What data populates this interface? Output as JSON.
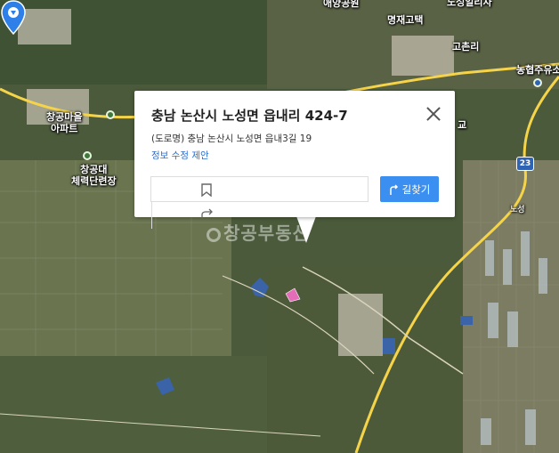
{
  "map": {
    "labels": [
      "애양공원",
      "명재고택",
      "노성일리사",
      "고촌리",
      "농협주유소",
      "창공마을\n아파트",
      "창공대\n체력단련장",
      "교",
      "노성"
    ],
    "route_badge": "23",
    "watermark": "창공부동산"
  },
  "popup": {
    "title": "충남 논산시 노성면 읍내리 424-7",
    "road_address": "(도로명) 충남 논산시 노성면 읍내3길 19",
    "edit_link": "정보 수정 제안",
    "route_button": "길찾기"
  },
  "colors": {
    "accent_blue": "#3b8ff0",
    "link_blue": "#2b6fd3",
    "pin_blue": "#2e80e8",
    "road_yellow": "#f5d44a"
  },
  "icons": [
    "close-icon",
    "bookmark-icon",
    "share-icon",
    "route-icon",
    "location-pin-icon",
    "poi-icon",
    "route-shield-icon"
  ]
}
